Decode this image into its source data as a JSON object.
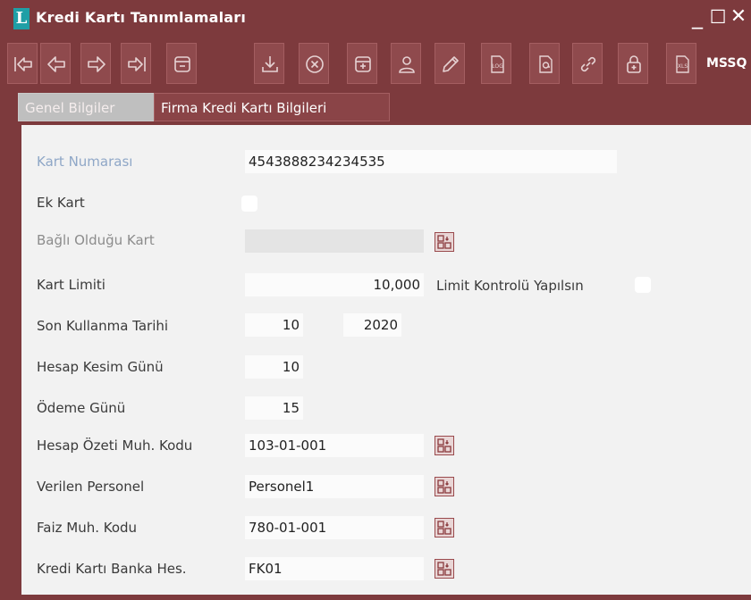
{
  "window": {
    "title": "Kredi Kartı Tanımlamaları",
    "logo_letter": "L",
    "controls": {
      "minimize": "_",
      "maximize": "☐",
      "close": "✕"
    }
  },
  "toolbar": {
    "buttons": [
      {
        "icon": "first-record-icon"
      },
      {
        "icon": "previous-record-icon"
      },
      {
        "icon": "next-record-icon"
      },
      {
        "icon": "last-record-icon"
      },
      {
        "icon": "minus-document-icon"
      },
      {
        "icon": "download-icon"
      },
      {
        "icon": "delete-icon"
      },
      {
        "icon": "add-document-icon"
      },
      {
        "icon": "user-icon"
      },
      {
        "icon": "pencil-icon"
      },
      {
        "icon": "log-icon",
        "label": "LOG"
      },
      {
        "icon": "email-document-icon"
      },
      {
        "icon": "link-icon"
      },
      {
        "icon": "lock-icon"
      },
      {
        "icon": "excel-icon",
        "label": "XLS"
      }
    ],
    "overflow_text": "MSSQ"
  },
  "tabs": [
    {
      "label": "Genel Bilgiler",
      "active": false
    },
    {
      "label": "Firma Kredi Kartı Bilgileri",
      "active": true
    }
  ],
  "form": {
    "kart_numarasi": {
      "label": "Kart Numarası",
      "value": "4543888234234535"
    },
    "ek_kart": {
      "label": "Ek Kart",
      "checked": false
    },
    "bagli_oldugu_kart": {
      "label": "Bağlı Olduğu Kart",
      "value": ""
    },
    "kart_limiti": {
      "label": "Kart Limiti",
      "value": "10,000"
    },
    "limit_kontrolu": {
      "label": "Limit Kontrolü Yapılsın",
      "checked": false
    },
    "son_kullanma_tarihi": {
      "label": "Son Kullanma Tarihi",
      "month": "10",
      "year": "2020"
    },
    "hesap_kesim_gunu": {
      "label": "Hesap Kesim Günü",
      "value": "10"
    },
    "odeme_gunu": {
      "label": "Ödeme Günü",
      "value": "15"
    },
    "hesap_ozeti_muh_kodu": {
      "label": "Hesap Özeti Muh. Kodu",
      "value": "103-01-001"
    },
    "verilen_personel": {
      "label": "Verilen Personel",
      "value": "Personel1"
    },
    "faiz_muh_kodu": {
      "label": "Faiz Muh. Kodu",
      "value": "780-01-001"
    },
    "kredi_karti_banka_hes": {
      "label": "Kredi Kartı Banka Hes.",
      "value": "FK01"
    }
  },
  "colors": {
    "frame": "#7d3a3d",
    "toolbar_button": "#8f4a4d",
    "active_tab": "#8a4447",
    "inactive_tab": "#bfbfbf",
    "panel": "#f2f2f2",
    "label_highlight": "#8fa7c7"
  }
}
